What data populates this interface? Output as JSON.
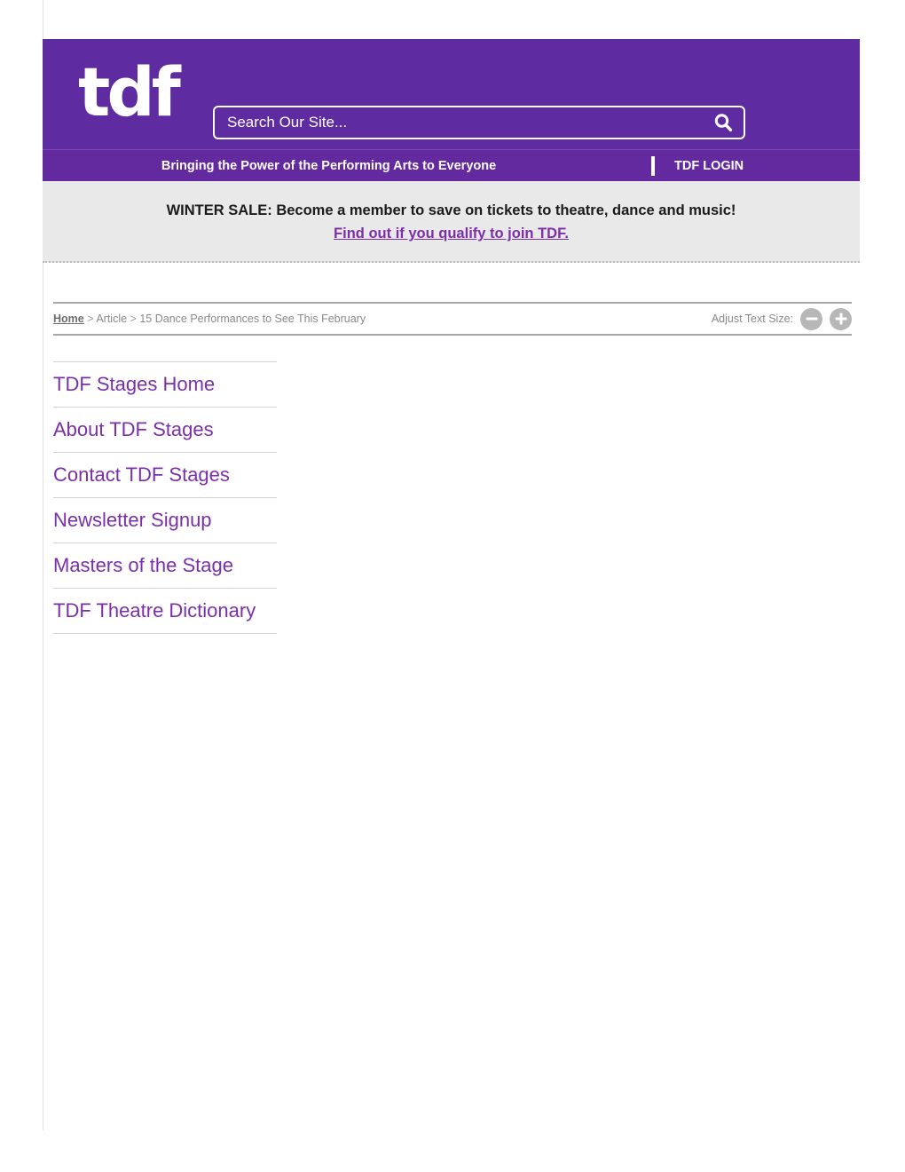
{
  "site": {
    "logo_text": "tdf",
    "brand_purple": "#5f2ba0",
    "link_purple": "#7b2fa8"
  },
  "search": {
    "placeholder": "Search Our Site...",
    "value": "",
    "icon": "search-icon"
  },
  "tagline_bar": {
    "tagline": "Bringing the Power of the Performing Arts to Everyone",
    "login_label": "TDF LOGIN"
  },
  "promo_banner": {
    "headline": "WINTER SALE: Become a member to save on tickets to theatre, dance and music!",
    "link_text": "Find out if you qualify to join TDF."
  },
  "breadcrumb": {
    "home": "Home",
    "separator": ">",
    "section": "Article",
    "current": "15 Dance Performances to See This February"
  },
  "text_size": {
    "label": "Adjust Text Size:",
    "decrease_icon": "minus-circle-icon",
    "increase_icon": "plus-circle-icon"
  },
  "sidebar": {
    "items": [
      {
        "label": "TDF Stages Home"
      },
      {
        "label": "About TDF Stages"
      },
      {
        "label": "Contact TDF Stages"
      },
      {
        "label": "Newsletter Signup"
      },
      {
        "label": "Masters of the Stage"
      },
      {
        "label": "TDF Theatre Dictionary"
      }
    ]
  }
}
